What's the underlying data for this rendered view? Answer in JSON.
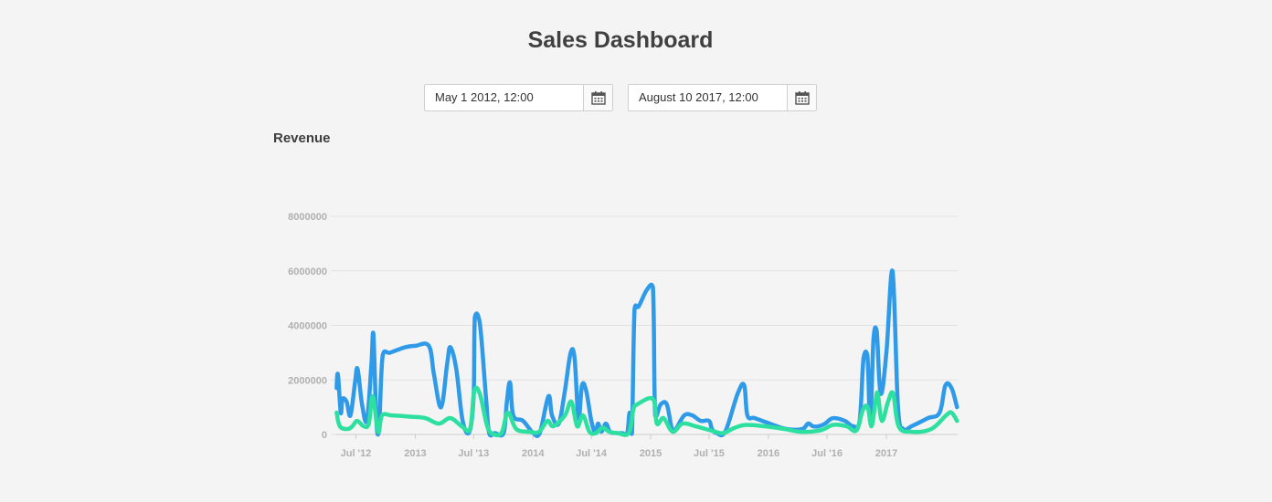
{
  "header": {
    "title": "Sales Dashboard"
  },
  "date_range": {
    "start": "May 1 2012, 12:00",
    "end": "August 10 2017, 12:00"
  },
  "icons": {
    "calendar": "calendar-icon"
  },
  "chart_data": {
    "type": "line",
    "title": "Revenue",
    "ylim": [
      0,
      8000000
    ],
    "yticks": [
      0,
      2000000,
      4000000,
      6000000,
      8000000
    ],
    "ytick_labels": [
      "0",
      "2000000",
      "4000000",
      "6000000",
      "8000000"
    ],
    "xlim": [
      "2012-05-01",
      "2017-08-10"
    ],
    "xticks": [
      "2012-07-01",
      "2013-01-01",
      "2013-07-01",
      "2014-01-01",
      "2014-07-01",
      "2015-01-01",
      "2015-07-01",
      "2016-01-01",
      "2016-07-01",
      "2017-01-01"
    ],
    "xtick_labels": [
      "Jul '12",
      "2013",
      "Jul '13",
      "2014",
      "Jul '14",
      "2015",
      "Jul '15",
      "2016",
      "Jul '16",
      "2017"
    ],
    "grid": true,
    "colors": [
      "#2f9be8",
      "#2ee0a0"
    ],
    "series": [
      {
        "points": [
          [
            "2012-05-02",
            1700000
          ],
          [
            "2012-05-06",
            2200000
          ],
          [
            "2012-05-15",
            800000
          ],
          [
            "2012-05-20",
            1300000
          ],
          [
            "2012-06-02",
            1200000
          ],
          [
            "2012-06-14",
            700000
          ],
          [
            "2012-06-28",
            1900000
          ],
          [
            "2012-07-06",
            2400000
          ],
          [
            "2012-07-20",
            1100000
          ],
          [
            "2012-08-04",
            500000
          ],
          [
            "2012-08-18",
            2600000
          ],
          [
            "2012-08-24",
            3700000
          ],
          [
            "2012-09-02",
            600000
          ],
          [
            "2012-09-10",
            100000
          ],
          [
            "2012-09-22",
            2900000
          ],
          [
            "2012-10-15",
            3000000
          ],
          [
            "2012-12-01",
            3200000
          ],
          [
            "2013-01-01",
            3250000
          ],
          [
            "2013-02-12",
            3250000
          ],
          [
            "2013-02-28",
            2200000
          ],
          [
            "2013-03-22",
            1000000
          ],
          [
            "2013-04-10",
            2600000
          ],
          [
            "2013-04-20",
            3200000
          ],
          [
            "2013-05-08",
            2400000
          ],
          [
            "2013-05-28",
            500000
          ],
          [
            "2013-06-18",
            100000
          ],
          [
            "2013-07-01",
            1400000
          ],
          [
            "2013-07-05",
            4300000
          ],
          [
            "2013-07-20",
            4100000
          ],
          [
            "2013-08-08",
            1400000
          ],
          [
            "2013-08-18",
            50000
          ],
          [
            "2013-09-05",
            50000
          ],
          [
            "2013-10-02",
            50000
          ],
          [
            "2013-10-12",
            1200000
          ],
          [
            "2013-10-22",
            1900000
          ],
          [
            "2013-11-01",
            700000
          ],
          [
            "2013-12-01",
            500000
          ],
          [
            "2014-01-02",
            50000
          ],
          [
            "2014-01-22",
            50000
          ],
          [
            "2014-02-18",
            1400000
          ],
          [
            "2014-03-01",
            700000
          ],
          [
            "2014-03-22",
            400000
          ],
          [
            "2014-04-10",
            1600000
          ],
          [
            "2014-04-28",
            3000000
          ],
          [
            "2014-05-10",
            2800000
          ],
          [
            "2014-05-22",
            600000
          ],
          [
            "2014-06-02",
            1800000
          ],
          [
            "2014-06-15",
            1600000
          ],
          [
            "2014-07-01",
            500000
          ],
          [
            "2014-07-14",
            50000
          ],
          [
            "2014-07-22",
            400000
          ],
          [
            "2014-08-01",
            100000
          ],
          [
            "2014-08-15",
            400000
          ],
          [
            "2014-08-28",
            100000
          ],
          [
            "2014-09-18",
            50000
          ],
          [
            "2014-10-05",
            50000
          ],
          [
            "2014-10-20",
            50000
          ],
          [
            "2014-10-28",
            800000
          ],
          [
            "2014-11-04",
            50000
          ],
          [
            "2014-11-12",
            4600000
          ],
          [
            "2014-11-25",
            4700000
          ],
          [
            "2014-12-20",
            5300000
          ],
          [
            "2015-01-08",
            5400000
          ],
          [
            "2015-01-15",
            700000
          ],
          [
            "2015-02-01",
            1100000
          ],
          [
            "2015-02-20",
            1100000
          ],
          [
            "2015-03-08",
            200000
          ],
          [
            "2015-03-20",
            200000
          ],
          [
            "2015-04-15",
            700000
          ],
          [
            "2015-05-10",
            700000
          ],
          [
            "2015-06-05",
            500000
          ],
          [
            "2015-07-01",
            500000
          ],
          [
            "2015-07-10",
            200000
          ],
          [
            "2015-07-25",
            50000
          ],
          [
            "2015-08-20",
            100000
          ],
          [
            "2015-09-28",
            1500000
          ],
          [
            "2015-10-18",
            1800000
          ],
          [
            "2015-10-28",
            700000
          ],
          [
            "2015-11-20",
            600000
          ],
          [
            "2016-01-05",
            400000
          ],
          [
            "2016-02-25",
            200000
          ],
          [
            "2016-04-15",
            200000
          ],
          [
            "2016-05-03",
            400000
          ],
          [
            "2016-05-18",
            300000
          ],
          [
            "2016-06-05",
            300000
          ],
          [
            "2016-06-25",
            400000
          ],
          [
            "2016-07-10",
            550000
          ],
          [
            "2016-07-25",
            600000
          ],
          [
            "2016-08-25",
            500000
          ],
          [
            "2016-09-20",
            300000
          ],
          [
            "2016-10-10",
            500000
          ],
          [
            "2016-10-22",
            2800000
          ],
          [
            "2016-11-03",
            2900000
          ],
          [
            "2016-11-12",
            500000
          ],
          [
            "2016-11-22",
            3500000
          ],
          [
            "2016-12-02",
            3800000
          ],
          [
            "2016-12-14",
            1500000
          ],
          [
            "2017-01-01",
            3000000
          ],
          [
            "2017-01-20",
            6000000
          ],
          [
            "2017-02-06",
            1000000
          ],
          [
            "2017-02-22",
            200000
          ],
          [
            "2017-03-20",
            300000
          ],
          [
            "2017-05-10",
            600000
          ],
          [
            "2017-06-15",
            800000
          ],
          [
            "2017-07-03",
            1800000
          ],
          [
            "2017-07-22",
            1700000
          ],
          [
            "2017-08-08",
            1000000
          ]
        ]
      },
      {
        "points": [
          [
            "2012-05-02",
            800000
          ],
          [
            "2012-05-12",
            300000
          ],
          [
            "2012-06-05",
            200000
          ],
          [
            "2012-06-20",
            300000
          ],
          [
            "2012-07-05",
            500000
          ],
          [
            "2012-07-25",
            300000
          ],
          [
            "2012-08-10",
            400000
          ],
          [
            "2012-08-22",
            1400000
          ],
          [
            "2012-09-08",
            100000
          ],
          [
            "2012-09-20",
            700000
          ],
          [
            "2012-10-20",
            700000
          ],
          [
            "2012-12-20",
            650000
          ],
          [
            "2013-02-01",
            600000
          ],
          [
            "2013-03-15",
            400000
          ],
          [
            "2013-04-20",
            600000
          ],
          [
            "2013-05-25",
            300000
          ],
          [
            "2013-06-20",
            200000
          ],
          [
            "2013-07-03",
            1600000
          ],
          [
            "2013-07-20",
            1500000
          ],
          [
            "2013-08-10",
            400000
          ],
          [
            "2013-08-25",
            50000
          ],
          [
            "2013-09-25",
            50000
          ],
          [
            "2013-10-15",
            800000
          ],
          [
            "2013-11-10",
            200000
          ],
          [
            "2013-12-20",
            100000
          ],
          [
            "2014-01-20",
            100000
          ],
          [
            "2014-02-15",
            500000
          ],
          [
            "2014-03-05",
            300000
          ],
          [
            "2014-04-10",
            700000
          ],
          [
            "2014-04-30",
            1200000
          ],
          [
            "2014-05-18",
            300000
          ],
          [
            "2014-06-05",
            700000
          ],
          [
            "2014-06-25",
            100000
          ],
          [
            "2014-07-15",
            50000
          ],
          [
            "2014-08-05",
            250000
          ],
          [
            "2014-08-25",
            100000
          ],
          [
            "2014-09-20",
            50000
          ],
          [
            "2014-10-25",
            50000
          ],
          [
            "2014-11-08",
            900000
          ],
          [
            "2014-11-20",
            1100000
          ],
          [
            "2015-01-08",
            1300000
          ],
          [
            "2015-01-20",
            400000
          ],
          [
            "2015-02-10",
            600000
          ],
          [
            "2015-03-10",
            100000
          ],
          [
            "2015-04-10",
            400000
          ],
          [
            "2015-05-20",
            300000
          ],
          [
            "2015-06-20",
            200000
          ],
          [
            "2015-07-20",
            100000
          ],
          [
            "2015-08-15",
            50000
          ],
          [
            "2015-09-20",
            250000
          ],
          [
            "2015-10-25",
            350000
          ],
          [
            "2015-12-20",
            300000
          ],
          [
            "2016-02-20",
            200000
          ],
          [
            "2016-04-10",
            100000
          ],
          [
            "2016-06-10",
            150000
          ],
          [
            "2016-07-20",
            350000
          ],
          [
            "2016-08-30",
            300000
          ],
          [
            "2016-09-30",
            150000
          ],
          [
            "2016-10-20",
            900000
          ],
          [
            "2016-11-04",
            1000000
          ],
          [
            "2016-11-16",
            300000
          ],
          [
            "2016-11-28",
            1200000
          ],
          [
            "2016-12-05",
            1500000
          ],
          [
            "2016-12-18",
            500000
          ],
          [
            "2017-01-06",
            1200000
          ],
          [
            "2017-01-22",
            1500000
          ],
          [
            "2017-02-08",
            300000
          ],
          [
            "2017-03-20",
            100000
          ],
          [
            "2017-05-20",
            200000
          ],
          [
            "2017-07-05",
            700000
          ],
          [
            "2017-07-22",
            800000
          ],
          [
            "2017-08-08",
            500000
          ]
        ]
      }
    ]
  }
}
